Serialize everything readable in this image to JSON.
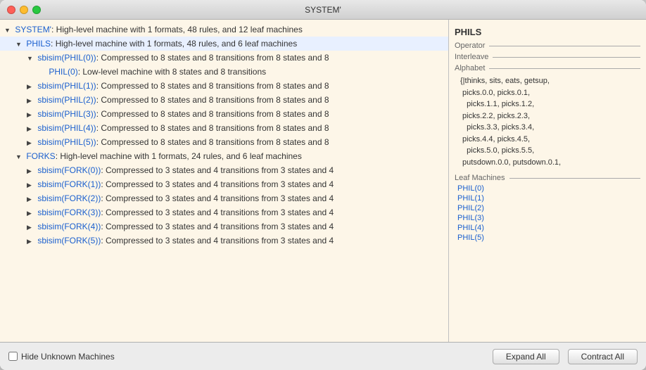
{
  "window": {
    "title": "SYSTEM'"
  },
  "tree": {
    "items": [
      {
        "id": "system",
        "level": 0,
        "arrow": "▼",
        "label_blue": "SYSTEM'",
        "label_black": ": High-level machine with 1 formats, 48 rules, and 12 leaf machines",
        "expanded": true
      },
      {
        "id": "phils",
        "level": 1,
        "arrow": "▼",
        "label_blue": "PHILS",
        "label_black": ": High-level machine with 1 formats, 48 rules, and 6 leaf machines",
        "expanded": true
      },
      {
        "id": "sbisim_phil0",
        "level": 2,
        "arrow": "▼",
        "label_blue": "sbisim(PHIL(0))",
        "label_black": ": Compressed to 8 states and 8 transitions from 8 states and 8",
        "expanded": true
      },
      {
        "id": "phil0",
        "level": 3,
        "arrow": "",
        "label_blue": "PHIL(0)",
        "label_black": ": Low-level machine with 8 states and 8 transitions",
        "expanded": false
      },
      {
        "id": "sbisim_phil1",
        "level": 2,
        "arrow": "▶",
        "label_blue": "sbisim(PHIL(1))",
        "label_black": ": Compressed to 8 states and 8 transitions from 8 states and 8",
        "expanded": false
      },
      {
        "id": "sbisim_phil2",
        "level": 2,
        "arrow": "▶",
        "label_blue": "sbisim(PHIL(2))",
        "label_black": ": Compressed to 8 states and 8 transitions from 8 states and 8",
        "expanded": false
      },
      {
        "id": "sbisim_phil3",
        "level": 2,
        "arrow": "▶",
        "label_blue": "sbisim(PHIL(3))",
        "label_black": ": Compressed to 8 states and 8 transitions from 8 states and 8",
        "expanded": false
      },
      {
        "id": "sbisim_phil4",
        "level": 2,
        "arrow": "▶",
        "label_blue": "sbisim(PHIL(4))",
        "label_black": ": Compressed to 8 states and 8 transitions from 8 states and 8",
        "expanded": false
      },
      {
        "id": "sbisim_phil5",
        "level": 2,
        "arrow": "▶",
        "label_blue": "sbisim(PHIL(5))",
        "label_black": ": Compressed to 8 states and 8 transitions from 8 states and 8",
        "expanded": false
      },
      {
        "id": "forks",
        "level": 1,
        "arrow": "▼",
        "label_blue": "FORKS",
        "label_black": ": High-level machine with 1 formats, 24 rules, and 6 leaf machines",
        "expanded": true
      },
      {
        "id": "sbisim_fork0",
        "level": 2,
        "arrow": "▶",
        "label_blue": "sbisim(FORK(0))",
        "label_black": ": Compressed to 3 states and 4 transitions from 3 states and 4",
        "expanded": false
      },
      {
        "id": "sbisim_fork1",
        "level": 2,
        "arrow": "▶",
        "label_blue": "sbisim(FORK(1))",
        "label_black": ": Compressed to 3 states and 4 transitions from 3 states and 4",
        "expanded": false
      },
      {
        "id": "sbisim_fork2",
        "level": 2,
        "arrow": "▶",
        "label_blue": "sbisim(FORK(2))",
        "label_black": ": Compressed to 3 states and 4 transitions from 3 states and 4",
        "expanded": false
      },
      {
        "id": "sbisim_fork3",
        "level": 2,
        "arrow": "▶",
        "label_blue": "sbisim(FORK(3))",
        "label_black": ": Compressed to 3 states and 4 transitions from 3 states and 4",
        "expanded": false
      },
      {
        "id": "sbisim_fork4",
        "level": 2,
        "arrow": "▶",
        "label_blue": "sbisim(FORK(4))",
        "label_black": ": Compressed to 3 states and 4 transitions from 3 states and 4",
        "expanded": false
      },
      {
        "id": "sbisim_fork5",
        "level": 2,
        "arrow": "▶",
        "label_blue": "sbisim(FORK(5))",
        "label_black": ": Compressed to 3 states and 4 transitions from 3 states and 4",
        "expanded": false
      }
    ]
  },
  "right_panel": {
    "title": "PHILS",
    "sections": {
      "operator": {
        "header": "Operator",
        "content": ""
      },
      "interleave": {
        "header": "Interleave",
        "content": ""
      },
      "alphabet": {
        "header": "Alphabet",
        "content": "{|thinks, sits, eats, getsup,\n picks.0.0, picks.0.1,\n   picks.1.1, picks.1.2,\n picks.2.2, picks.2.3,\n   picks.3.3, picks.3.4,\n picks.4.4, picks.4.5,\n   picks.5.0, picks.5.5,\n putsdown.0.0, putsdown.0.1,"
      },
      "leaf_machines": {
        "header": "Leaf Machines",
        "items": [
          "PHIL(0)",
          "PHIL(1)",
          "PHIL(2)",
          "PHIL(3)",
          "PHIL(4)",
          "PHIL(5)"
        ]
      }
    }
  },
  "bottom": {
    "checkbox_label": "Hide Unknown Machines",
    "expand_all": "Expand All",
    "contract_all": "Contract All"
  }
}
